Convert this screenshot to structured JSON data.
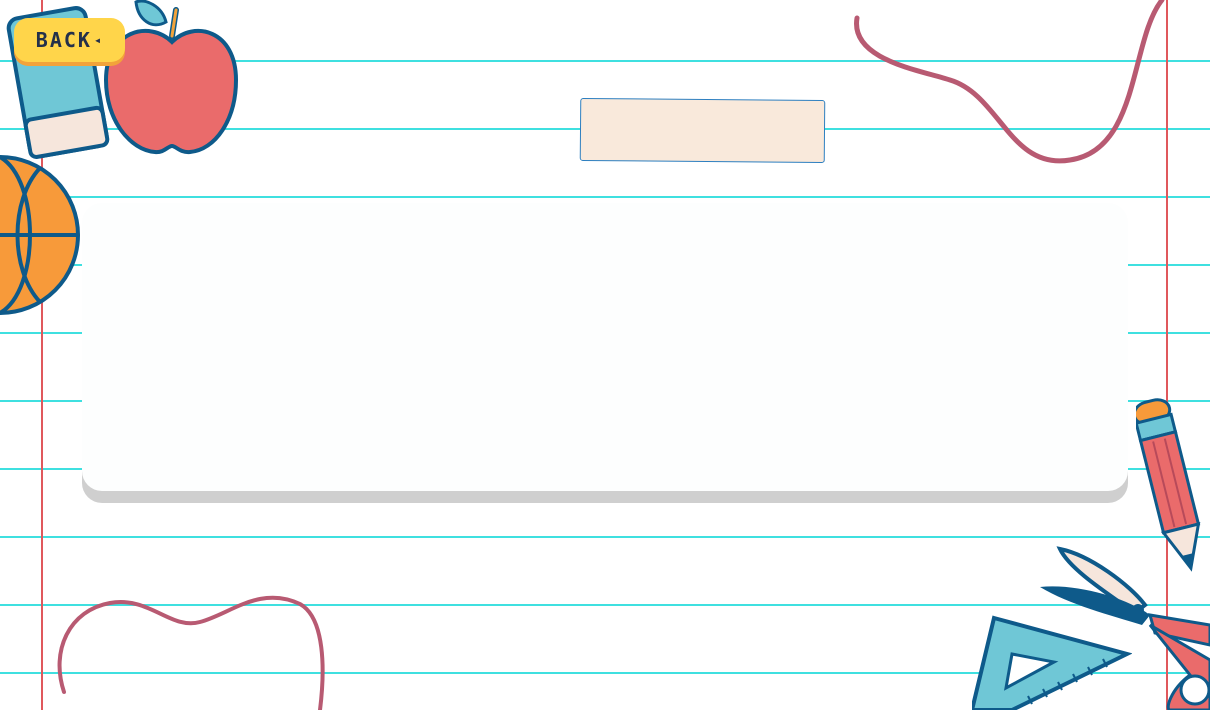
{
  "header": {
    "back_label": "BACK",
    "back_arrow": "◂",
    "title": ""
  },
  "main": {
    "card_text": ""
  },
  "decorations": {
    "icons": [
      "eraser-icon",
      "apple-icon",
      "basketball-icon",
      "pencil-icon",
      "scissors-icon",
      "set-square-icon",
      "scribble-line"
    ]
  },
  "colors": {
    "line": "#3fe0e0",
    "margin": "#e0585c",
    "button": "#ffd54a",
    "tape": "#f9e9db"
  }
}
